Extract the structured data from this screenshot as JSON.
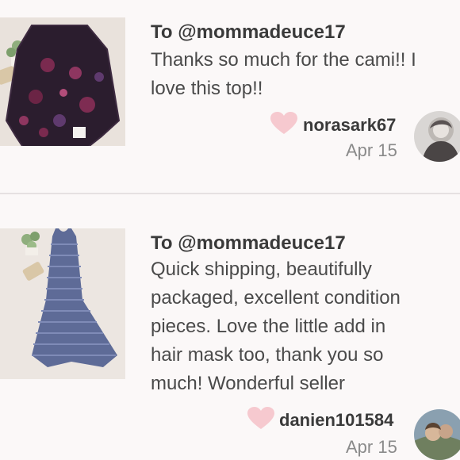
{
  "reviews": [
    {
      "to": "To @mommadeuce17",
      "message": "Thanks so much for the cami!! I\nlove this top!!",
      "username": "norasark67",
      "date": "Apr 15",
      "thumbnail": "floral-top-photo",
      "avatar": "user-avatar-photo"
    },
    {
      "to": "To @mommadeuce17",
      "message": "Quick shipping, beautifully\npackaged, excellent condition\npieces. Love the little add in\nhair mask too, thank you so\nmuch! Wonderful seller",
      "username": "danien101584",
      "date": "Apr 15",
      "thumbnail": "striped-dress-photo",
      "avatar": "user-avatar-photo"
    }
  ],
  "colors": {
    "background": "#fbf8f8",
    "heart": "#f6c9cf",
    "text": "#3a3a3a",
    "muted": "#8a8a8a"
  }
}
